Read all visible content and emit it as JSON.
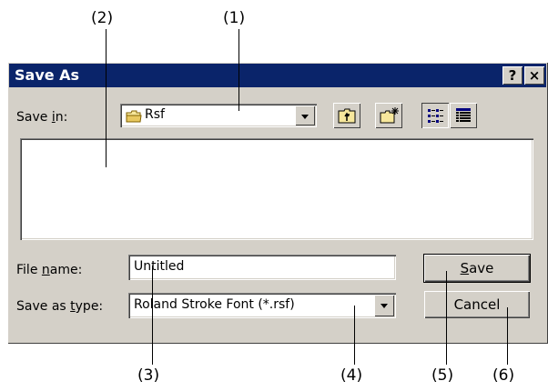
{
  "callouts": {
    "c1": "(1)",
    "c2": "(2)",
    "c3": "(3)",
    "c4": "(4)",
    "c5": "(5)",
    "c6": "(6)"
  },
  "dialog": {
    "title": "Save As",
    "help_button": "?",
    "close_button": "×"
  },
  "save_in": {
    "label_pre": "Save ",
    "label_accel": "i",
    "label_post": "n:",
    "value": "Rsf",
    "folder_icon": "folder-icon"
  },
  "toolbar": {
    "up_icon": "up-one-level-icon",
    "new_folder_icon": "new-folder-icon",
    "list_icon": "list-view-icon",
    "details_icon": "details-view-icon"
  },
  "file_name": {
    "label_pre": "File ",
    "label_accel": "n",
    "label_post": "ame:",
    "value": "Untitled"
  },
  "save_as_type": {
    "label_pre": "Save as ",
    "label_accel": "t",
    "label_post": "ype:",
    "value": "Roland Stroke Font (*.rsf)"
  },
  "buttons": {
    "save_accel": "S",
    "save_rest": "ave",
    "cancel": "Cancel"
  }
}
